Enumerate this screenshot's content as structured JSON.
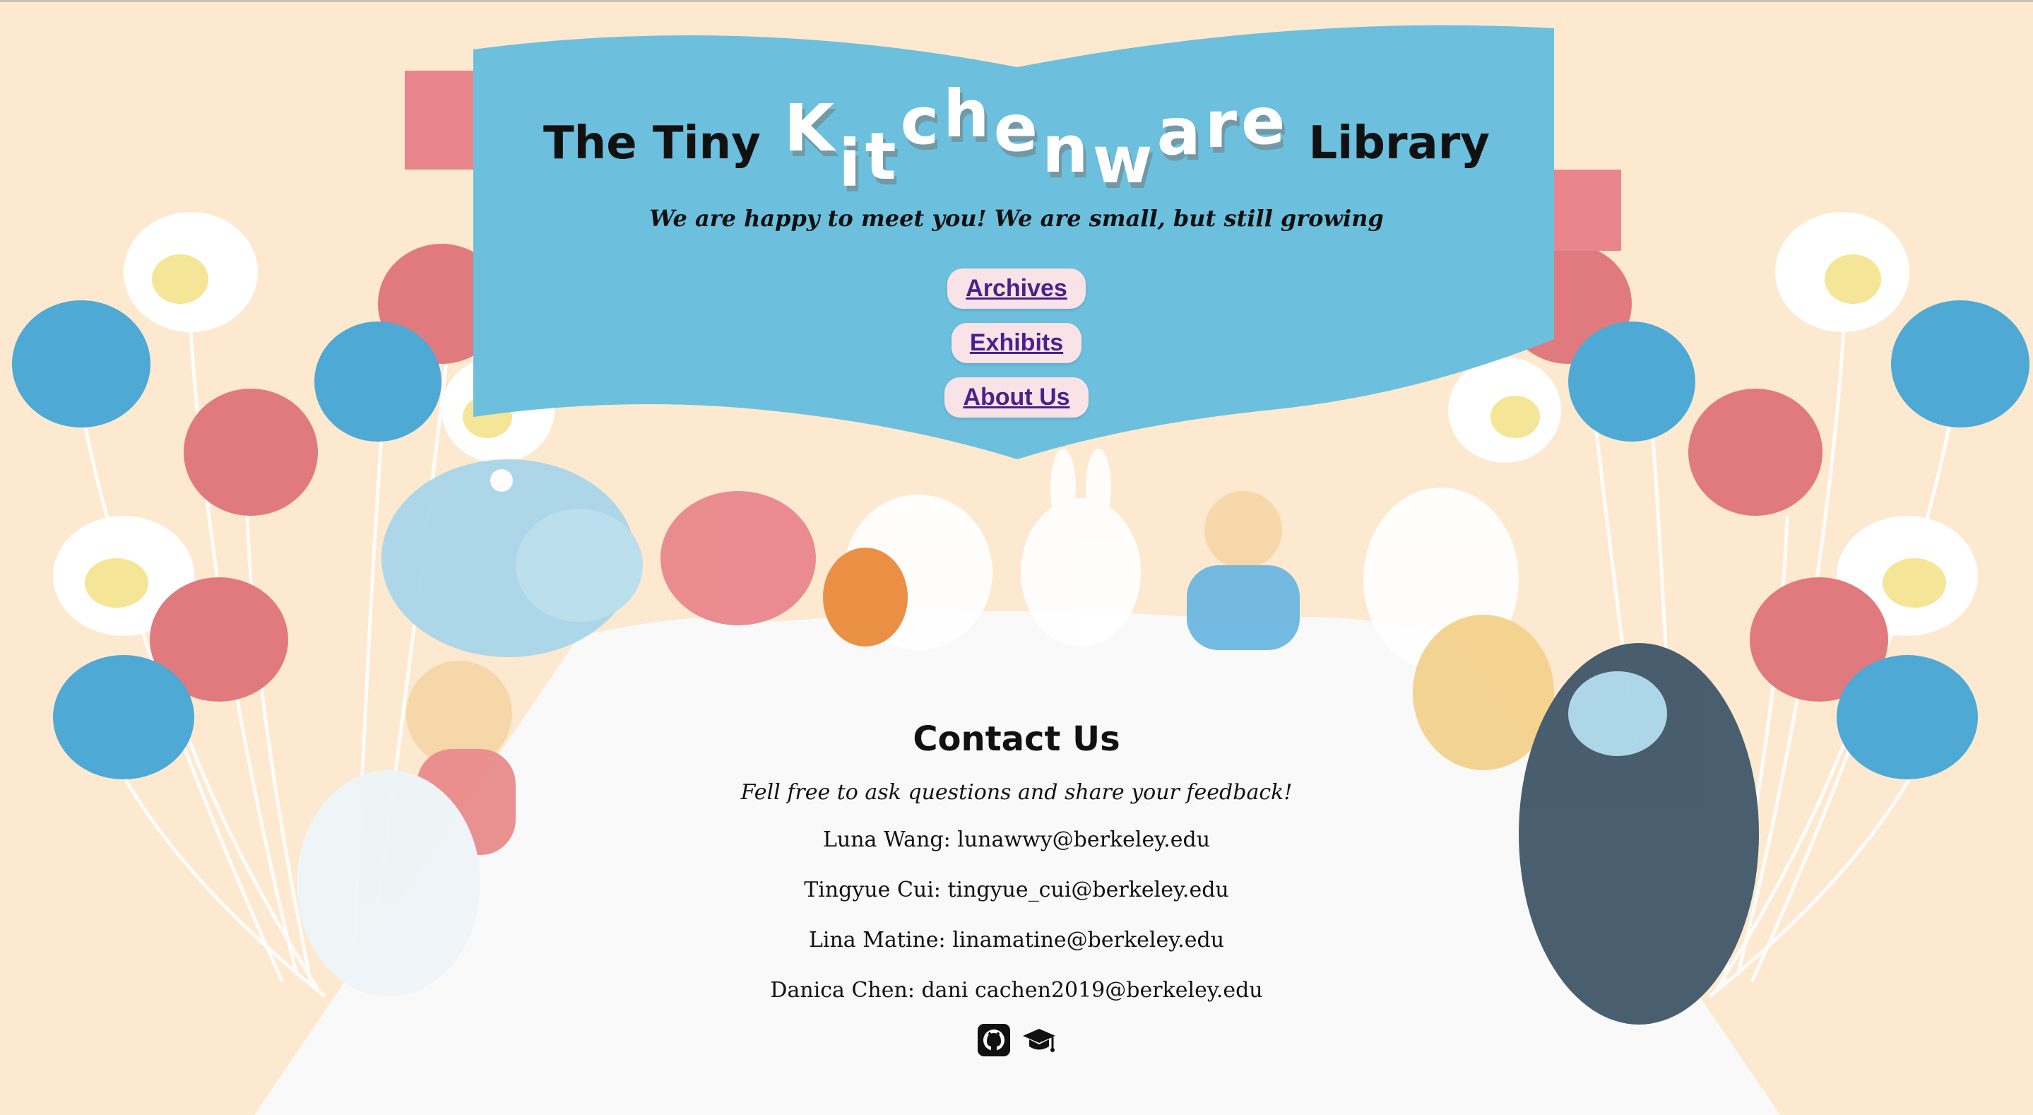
{
  "header": {
    "title_prefix": "The Tiny",
    "title_fancy_letters": [
      "K",
      "i",
      "t",
      "c",
      "h",
      "e",
      "n",
      "w",
      "a",
      "r",
      "e"
    ],
    "title_suffix": "Library",
    "subtitle": "We are happy to meet you! We are small, but still growing"
  },
  "nav": {
    "items": [
      {
        "label": "Archives"
      },
      {
        "label": "Exhibits"
      },
      {
        "label": "About Us"
      }
    ]
  },
  "contact": {
    "heading": "Contact Us",
    "lead": "Fell free to ask questions and share your feedback!",
    "lines": [
      "Luna Wang: lunawwy@berkeley.edu",
      "Tingyue Cui: tingyue_cui@berkeley.edu",
      "Lina Matine: linamatine@berkeley.edu",
      "Danica Chen: dani cachen2019@berkeley.edu"
    ],
    "icons": [
      "github-icon",
      "graduation-cap-icon"
    ]
  },
  "colors": {
    "background": "#fde9cf",
    "book_blue": "#6cc0dd",
    "table_white": "#f9f9f9",
    "nav_pill": "#fae3e6",
    "link": "#4d1f8c",
    "balloon_red": "#e07a7e",
    "balloon_blue": "#4ea9d4"
  }
}
